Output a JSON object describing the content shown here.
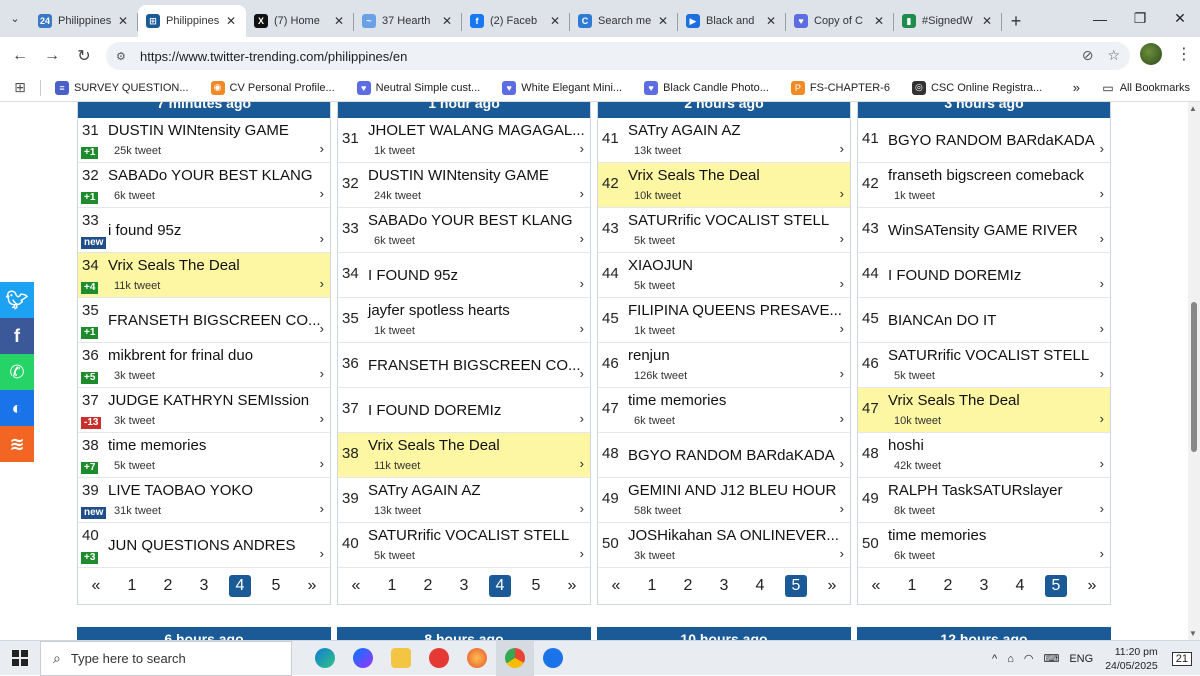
{
  "tabs": [
    {
      "title": "Philippines",
      "favicon": "24",
      "color": "#3a78c3",
      "active": false
    },
    {
      "title": "Philippines",
      "favicon": "⊞",
      "color": "#1a5a96",
      "active": true
    },
    {
      "title": "(7) Home",
      "favicon": "X",
      "color": "#111",
      "active": false
    },
    {
      "title": "37 Hearth",
      "favicon": "~",
      "color": "#6aa0e6",
      "active": false
    },
    {
      "title": "(2) Faceb",
      "favicon": "f",
      "color": "#1877f2",
      "active": false
    },
    {
      "title": "Search me",
      "favicon": "C",
      "color": "#2e7bd6",
      "active": false
    },
    {
      "title": "Black and",
      "favicon": "▶",
      "color": "#1d6fe0",
      "active": false
    },
    {
      "title": "Copy of C",
      "favicon": "♥",
      "color": "#5b6de0",
      "active": false
    },
    {
      "title": "#SignedW",
      "favicon": "▮",
      "color": "#1e8c4c",
      "active": false
    }
  ],
  "window": {
    "minimize": "—",
    "restore": "❐",
    "close": "✕"
  },
  "address": {
    "url": "https://www.twitter-trending.com/philippines/en"
  },
  "bookmarks": [
    {
      "label": "SURVEY QUESTION...",
      "color": "#4a5fc7",
      "icon": "≡"
    },
    {
      "label": "CV Personal Profile...",
      "color": "#f08a24",
      "icon": "◉"
    },
    {
      "label": "Neutral Simple cust...",
      "color": "#5b6de0",
      "icon": "♥"
    },
    {
      "label": "White Elegant Mini...",
      "color": "#5b6de0",
      "icon": "♥"
    },
    {
      "label": "Black Candle Photo...",
      "color": "#5b6de0",
      "icon": "♥"
    },
    {
      "label": "FS-CHAPTER-6",
      "color": "#f08a24",
      "icon": "P"
    },
    {
      "label": "CSC Online Registra...",
      "color": "#333",
      "icon": "◎"
    }
  ],
  "bookmarks_more": "»",
  "all_bookmarks": "All Bookmarks",
  "columns": [
    {
      "header": "7 minutes ago",
      "rows": [
        {
          "rank": "31",
          "name": "DUSTIN WINtensity GAME",
          "count": "25k tweet",
          "badge": "+1",
          "badge_type": "up",
          "hl": false
        },
        {
          "rank": "32",
          "name": "SABADo YOUR BEST KLANG",
          "count": "6k tweet",
          "badge": "+1",
          "badge_type": "up",
          "hl": false
        },
        {
          "rank": "33",
          "name": "i found 95z",
          "count": "",
          "badge": "new",
          "badge_type": "new",
          "hl": false
        },
        {
          "rank": "34",
          "name": "Vrix Seals The Deal",
          "count": "11k tweet",
          "badge": "+4",
          "badge_type": "up",
          "hl": true
        },
        {
          "rank": "35",
          "name": "FRANSETH BIGSCREEN CO...",
          "count": "",
          "badge": "+1",
          "badge_type": "up",
          "hl": false
        },
        {
          "rank": "36",
          "name": "mikbrent for frinal duo",
          "count": "3k tweet",
          "badge": "+5",
          "badge_type": "up",
          "hl": false
        },
        {
          "rank": "37",
          "name": "JUDGE KATHRYN SEMIssion",
          "count": "3k tweet",
          "badge": "-13",
          "badge_type": "down",
          "hl": false
        },
        {
          "rank": "38",
          "name": "time memories",
          "count": "5k tweet",
          "badge": "+7",
          "badge_type": "up",
          "hl": false
        },
        {
          "rank": "39",
          "name": "LIVE TAOBAO YOKO",
          "count": "31k tweet",
          "badge": "new",
          "badge_type": "new",
          "hl": false
        },
        {
          "rank": "40",
          "name": "JUN QUESTIONS ANDRES",
          "count": "",
          "badge": "+3",
          "badge_type": "up",
          "hl": false
        }
      ],
      "pages": [
        "«",
        "1",
        "2",
        "3",
        "4",
        "5",
        "»"
      ],
      "current": "4"
    },
    {
      "header": "1 hour ago",
      "rows": [
        {
          "rank": "31",
          "name": "JHOLET WALANG MAGAGAL...",
          "count": "1k tweet",
          "hl": false
        },
        {
          "rank": "32",
          "name": "DUSTIN WINtensity GAME",
          "count": "24k tweet",
          "hl": false
        },
        {
          "rank": "33",
          "name": "SABADo YOUR BEST KLANG",
          "count": "6k tweet",
          "hl": false
        },
        {
          "rank": "34",
          "name": "I FOUND 95z",
          "count": "",
          "hl": false
        },
        {
          "rank": "35",
          "name": "jayfer spotless hearts",
          "count": "1k tweet",
          "hl": false
        },
        {
          "rank": "36",
          "name": "FRANSETH BIGSCREEN CO...",
          "count": "",
          "hl": false
        },
        {
          "rank": "37",
          "name": "I FOUND DOREMIz",
          "count": "",
          "hl": false
        },
        {
          "rank": "38",
          "name": "Vrix Seals The Deal",
          "count": "11k tweet",
          "hl": true
        },
        {
          "rank": "39",
          "name": "SATry AGAIN AZ",
          "count": "13k tweet",
          "hl": false
        },
        {
          "rank": "40",
          "name": "SATURrific VOCALIST STELL",
          "count": "5k tweet",
          "hl": false
        }
      ],
      "pages": [
        "«",
        "1",
        "2",
        "3",
        "4",
        "5",
        "»"
      ],
      "current": "4"
    },
    {
      "header": "2 hours ago",
      "rows": [
        {
          "rank": "41",
          "name": "SATry AGAIN AZ",
          "count": "13k tweet",
          "hl": false
        },
        {
          "rank": "42",
          "name": "Vrix Seals The Deal",
          "count": "10k tweet",
          "hl": true
        },
        {
          "rank": "43",
          "name": "SATURrific VOCALIST STELL",
          "count": "5k tweet",
          "hl": false
        },
        {
          "rank": "44",
          "name": "XIAOJUN",
          "count": "5k tweet",
          "hl": false
        },
        {
          "rank": "45",
          "name": "FILIPINA QUEENS PRESAVE...",
          "count": "1k tweet",
          "hl": false
        },
        {
          "rank": "46",
          "name": "renjun",
          "count": "126k tweet",
          "hl": false
        },
        {
          "rank": "47",
          "name": "time memories",
          "count": "6k tweet",
          "hl": false
        },
        {
          "rank": "48",
          "name": "BGYO RANDOM BARdaKADA",
          "count": "",
          "hl": false
        },
        {
          "rank": "49",
          "name": "GEMINI AND J12 BLEU HOUR",
          "count": "58k tweet",
          "hl": false
        },
        {
          "rank": "50",
          "name": "JOSHikahan SA ONLINEVER...",
          "count": "3k tweet",
          "hl": false
        }
      ],
      "pages": [
        "«",
        "1",
        "2",
        "3",
        "4",
        "5",
        "»"
      ],
      "current": "5"
    },
    {
      "header": "3 hours ago",
      "rows": [
        {
          "rank": "41",
          "name": "BGYO RANDOM BARdaKADA",
          "count": "",
          "hl": false
        },
        {
          "rank": "42",
          "name": "franseth bigscreen comeback",
          "count": "1k tweet",
          "hl": false
        },
        {
          "rank": "43",
          "name": "WinSATensity GAME RIVER",
          "count": "",
          "hl": false
        },
        {
          "rank": "44",
          "name": "I FOUND DOREMIz",
          "count": "",
          "hl": false
        },
        {
          "rank": "45",
          "name": "BIANCAn DO IT",
          "count": "",
          "hl": false
        },
        {
          "rank": "46",
          "name": "SATURrific VOCALIST STELL",
          "count": "5k tweet",
          "hl": false
        },
        {
          "rank": "47",
          "name": "Vrix Seals The Deal",
          "count": "10k tweet",
          "hl": true
        },
        {
          "rank": "48",
          "name": "hoshi",
          "count": "42k tweet",
          "hl": false
        },
        {
          "rank": "49",
          "name": "RALPH TaskSATURslayer",
          "count": "8k tweet",
          "hl": false
        },
        {
          "rank": "50",
          "name": "time memories",
          "count": "6k tweet",
          "hl": false
        }
      ],
      "pages": [
        "«",
        "1",
        "2",
        "3",
        "4",
        "5",
        "»"
      ],
      "current": "5"
    }
  ],
  "next_headers": [
    "6 hours ago",
    "8 hours ago",
    "10 hours ago",
    "12 hours ago"
  ],
  "taskbar": {
    "search_placeholder": "Type here to search",
    "lang": "ENG",
    "time": "11:20 pm",
    "date": "24/05/2025",
    "notifications": "21",
    "apps": [
      "edge",
      "messenger",
      "file-explorer",
      "wps",
      "firefox",
      "chrome",
      "chrome-alt"
    ]
  }
}
